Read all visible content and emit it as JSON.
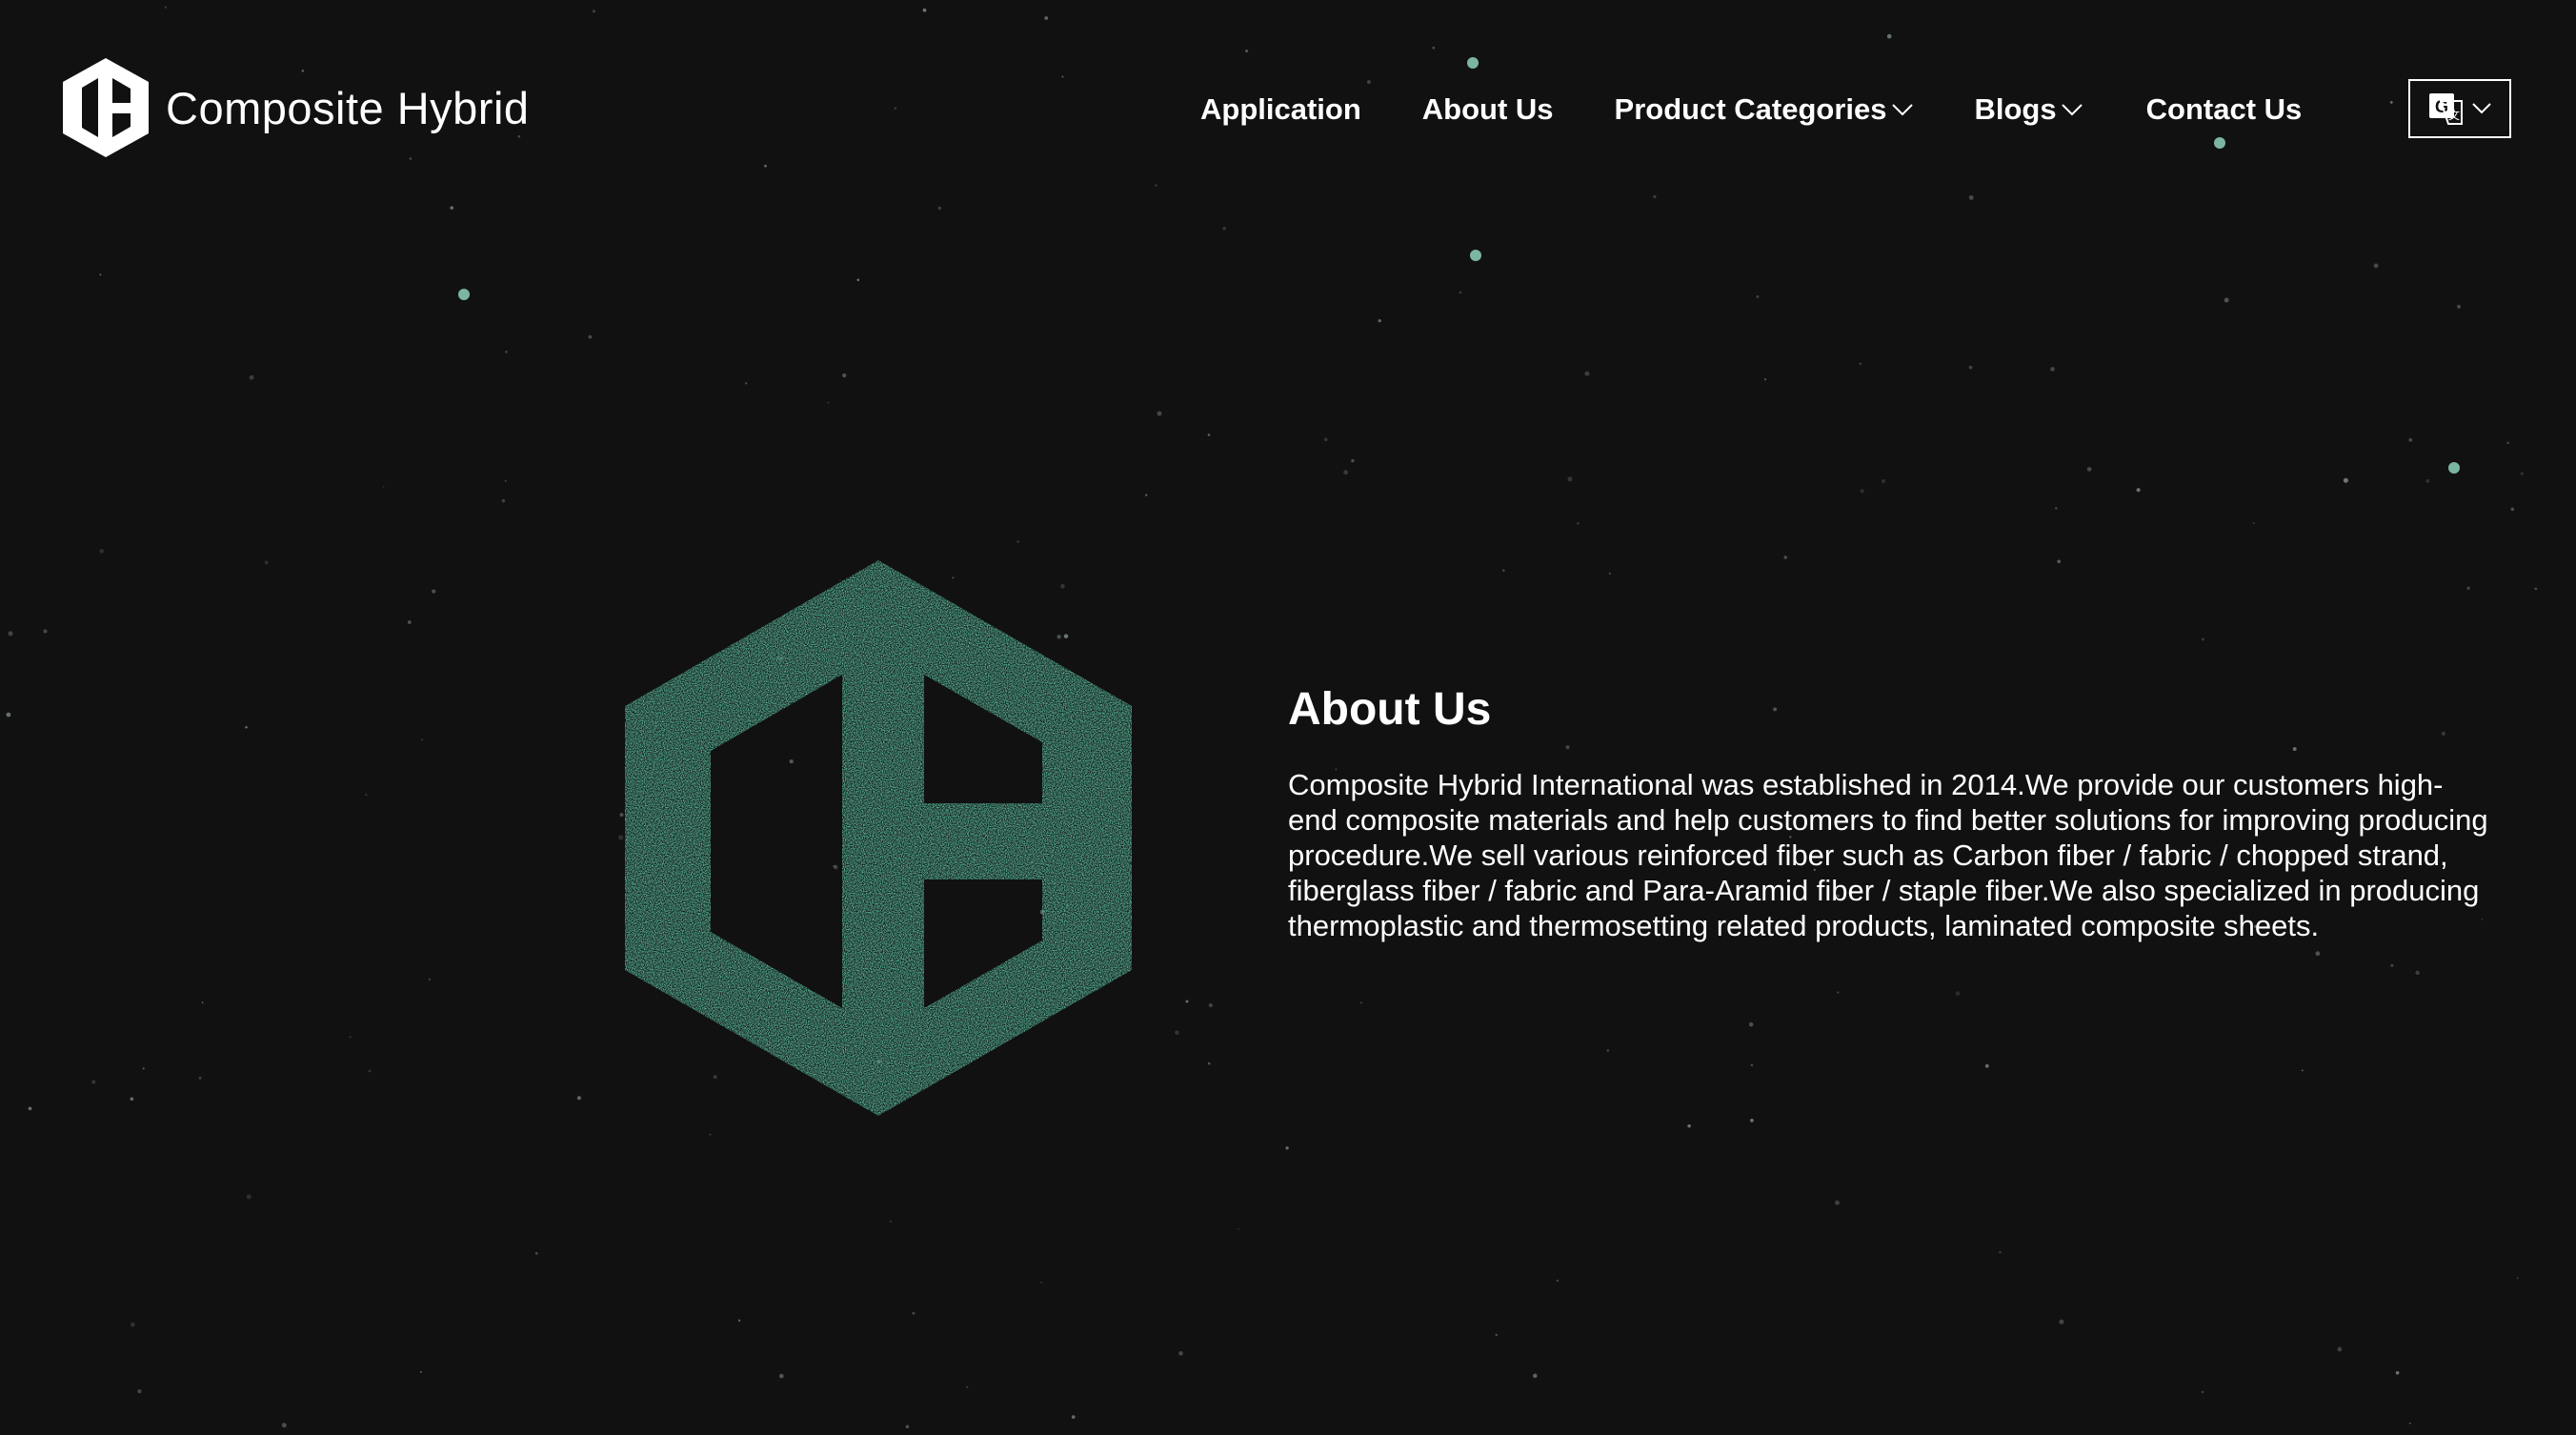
{
  "colors": {
    "background": "#111112",
    "accent": "#5cc1a1",
    "text": "#ffffff"
  },
  "header": {
    "brand_name": "Composite Hybrid",
    "nav": [
      {
        "label": "Application",
        "has_dropdown": false
      },
      {
        "label": "About Us",
        "has_dropdown": false
      },
      {
        "label": "Product Categories",
        "has_dropdown": true
      },
      {
        "label": "Blogs",
        "has_dropdown": true
      },
      {
        "label": "Contact Us",
        "has_dropdown": false
      }
    ],
    "language_icon": "google-translate-icon"
  },
  "about": {
    "heading": "About Us",
    "body": "Composite Hybrid International was established in 2014.We provide our customers high-end composite materials and help customers to find better solutions for improving producing procedure.We sell various reinforced fiber such as Carbon fiber / fabric / chopped strand, fiberglass fiber / fabric and Para-Aramid fiber / staple fiber.We also specialized in producing thermoplastic and thermosetting related products, laminated composite sheets."
  }
}
